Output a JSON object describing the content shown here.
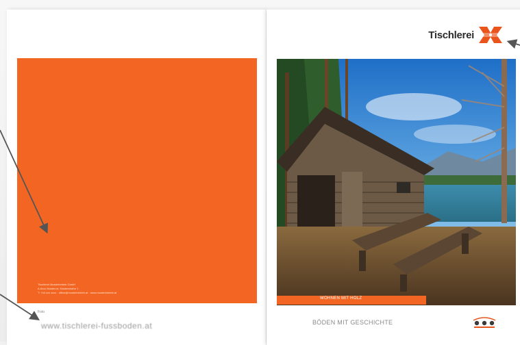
{
  "left_page": {
    "imprint_lines": [
      "Tischlerei Musterbetrieb GmbH",
      "A-6xxx Musterort, Musterstraße 1",
      "T: +43 xxx xxxx  ·  office@musterbetrieb.at  ·  www.musterbetrieb.at"
    ],
    "footer_small": "Foto",
    "web_url": "www.tischlerei-fussboden.at"
  },
  "right_page": {
    "brand_name": "Tischlerei",
    "photo_caption": "WOHNEN MIT HOLZ",
    "tagline": "BÖDEN MIT GESCHICHTE"
  },
  "colors": {
    "accent": "#f26522",
    "brand_icon": "#e8541c",
    "arrow": "#555555"
  }
}
